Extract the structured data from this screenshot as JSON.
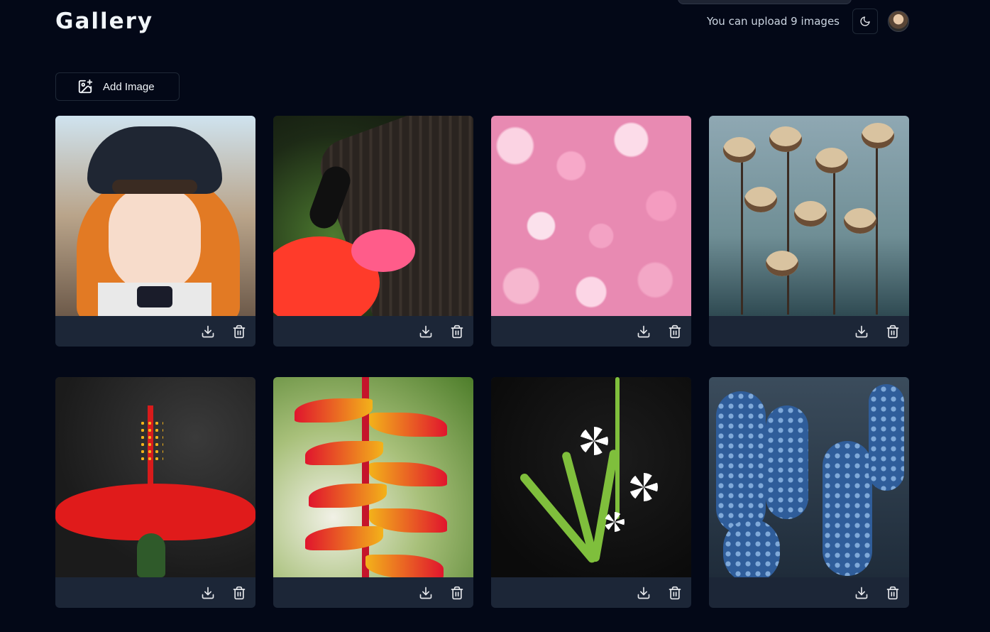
{
  "header": {
    "title": "Gallery",
    "upload_note": "You can upload 9 images",
    "theme_icon": "moon-icon",
    "avatar": "avatar"
  },
  "toolbar": {
    "add_image_label": "Add Image",
    "add_image_icon": "image-plus-icon"
  },
  "colors": {
    "background": "#030817",
    "card_bar": "#1c2637",
    "text": "#f1f5f9"
  },
  "gallery": {
    "cards": [
      {
        "image": "anime-girl",
        "actions": [
          "download-icon",
          "trash-icon"
        ]
      },
      {
        "image": "butterfly",
        "actions": [
          "download-icon",
          "trash-icon"
        ]
      },
      {
        "image": "pink-hydrangea",
        "actions": [
          "download-icon",
          "trash-icon"
        ]
      },
      {
        "image": "dried-flowers",
        "actions": [
          "download-icon",
          "trash-icon"
        ]
      },
      {
        "image": "red-hibiscus",
        "actions": [
          "download-icon",
          "trash-icon"
        ]
      },
      {
        "image": "heliconia-frog",
        "actions": [
          "download-icon",
          "trash-icon"
        ]
      },
      {
        "image": "white-spider-plant-flower",
        "actions": [
          "download-icon",
          "trash-icon"
        ]
      },
      {
        "image": "blue-muscari",
        "actions": [
          "download-icon",
          "trash-icon"
        ]
      }
    ]
  }
}
